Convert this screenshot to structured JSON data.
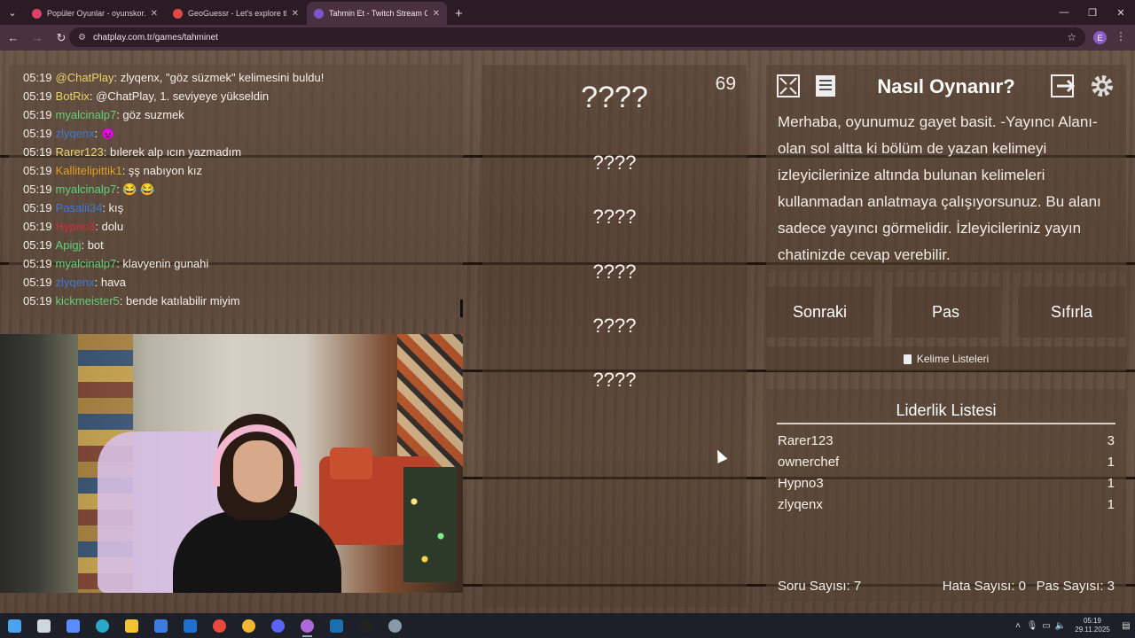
{
  "browser": {
    "tabs": [
      {
        "title": "Popüler Oyunlar - oyunskor.com",
        "active": false,
        "favicon_color": "#e0406a"
      },
      {
        "title": "GeoGuessr - Let's explore the world!",
        "active": false,
        "favicon_color": "#e04848"
      },
      {
        "title": "Tahmin Et - Twitch Stream Game",
        "active": true,
        "favicon_color": "#7f55cc"
      }
    ],
    "url": "chatplay.com.tr/games/tahminet",
    "profile_initial": "E"
  },
  "chat": {
    "messages": [
      {
        "time": "05:19",
        "user": "@ChatPlay",
        "color": "#e9d36a",
        "text": ": zlyqenx, \"göz süzmek\" kelimesini buldu!"
      },
      {
        "time": "05:19",
        "user": "BotRix",
        "color": "#e9d36a",
        "text": ": @ChatPlay, 1. seviyeye yükseldin"
      },
      {
        "time": "05:19",
        "user": "myalcinalp7",
        "color": "#5fd17a",
        "text": ": göz suzmek"
      },
      {
        "time": "05:19",
        "user": "zlyqenx",
        "color": "#3a7bd5",
        "text": ": 👿"
      },
      {
        "time": "05:19",
        "user": "Rarer123",
        "color": "#e9d36a",
        "text": ": bılerek alp ıcın yazmadım"
      },
      {
        "time": "05:19",
        "user": "Kallitelipittik1",
        "color": "#e0a020",
        "text": ": şş nabıyon kız"
      },
      {
        "time": "05:19",
        "user": "myalcinalp7",
        "color": "#5fd17a",
        "text": ": 😂 😂"
      },
      {
        "time": "05:19",
        "user": "Pasalii34",
        "color": "#3a7bd5",
        "text": ": kış"
      },
      {
        "time": "05:19",
        "user": "Hypno3",
        "color": "#d8283a",
        "text": ": dolu"
      },
      {
        "time": "05:19",
        "user": "Apigj",
        "color": "#5fd17a",
        "text": ": bot"
      },
      {
        "time": "05:19",
        "user": "myalcinalp7",
        "color": "#5fd17a",
        "text": ": klavyenin gunahi"
      },
      {
        "time": "05:19",
        "user": "zlyqenx",
        "color": "#3a7bd5",
        "text": ": hava"
      },
      {
        "time": "05:19",
        "user": "kickmeister5",
        "color": "#5fd17a",
        "text": ": bende katılabilir miyim"
      }
    ]
  },
  "game": {
    "timer": "69",
    "words": [
      "????",
      "????",
      "????",
      "????",
      "????",
      "????"
    ]
  },
  "howto": {
    "title": "Nasıl Oynanır?",
    "text": "Merhaba, oyunumuz gayet basit. -Yayıncı Alanı- olan sol altta ki bölüm de yazan kelimeyi izleyicilerinize altında bulunan kelimeleri kullanmadan anlatmaya çalışıyorsunuz. Bu alanı sadece yayıncı görmelidir. İzleyicileriniz yayın chatinizde cevap verebilir."
  },
  "actions": {
    "next": "Sonraki",
    "pass": "Pas",
    "reset": "Sıfırla"
  },
  "wordlists_label": "Kelime Listeleri",
  "leaderboard": {
    "title": "Liderlik Listesi",
    "rows": [
      {
        "name": "Rarer123",
        "score": "3"
      },
      {
        "name": "ownerchef",
        "score": "1"
      },
      {
        "name": "Hypno3",
        "score": "1"
      },
      {
        "name": "zlyqenx",
        "score": "1"
      }
    ]
  },
  "stats": {
    "questions": "Soru Sayısı: 7",
    "errors": "Hata Sayısı: 0",
    "passes": "Pas Sayısı: 3"
  },
  "taskbar": {
    "time": "05:19",
    "date": "29.11.2025",
    "apps": [
      "windows-start",
      "task-view",
      "copilot",
      "edge",
      "file-explorer",
      "store",
      "outlook",
      "chrome",
      "chrome-profile",
      "discord",
      "chrome-active",
      "steam",
      "obs",
      "other-app"
    ],
    "app_colors": [
      "#4aa3f0",
      "#cfd6df",
      "#5b8cff",
      "#2aa8c8",
      "#f1c232",
      "#3d7be0",
      "#1f6fd0",
      "#e8493b",
      "#f2b632",
      "#5865f2",
      "#b069d9",
      "#1b6fb0",
      "#222",
      "#8899aa"
    ]
  }
}
